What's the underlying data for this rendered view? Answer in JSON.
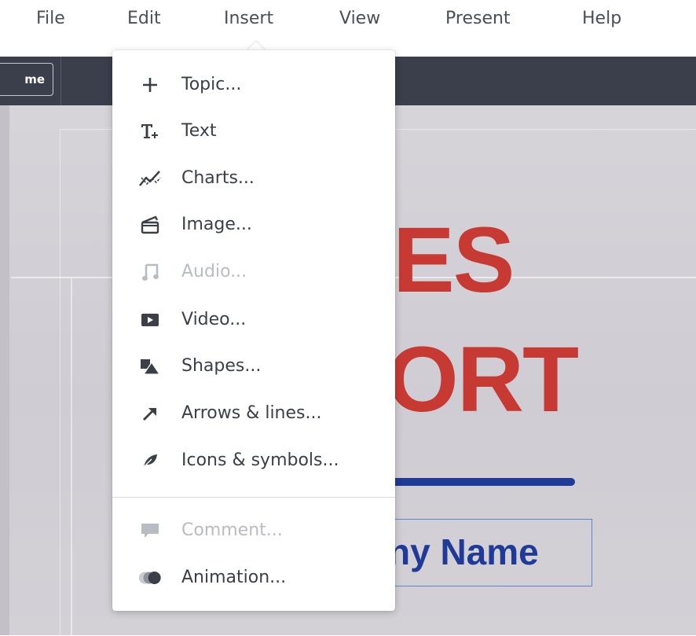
{
  "menubar": {
    "items": [
      {
        "label": "File"
      },
      {
        "label": "Edit"
      },
      {
        "label": "Insert"
      },
      {
        "label": "View"
      },
      {
        "label": "Present"
      },
      {
        "label": "Help"
      }
    ]
  },
  "toolbar": {
    "theme_button_label": "me"
  },
  "slide": {
    "title_line_1": "ES",
    "title_line_2": "ORT",
    "subtitle": "ny Name",
    "colors": {
      "title": "#c63a33",
      "accent": "#1f3a97"
    }
  },
  "insert_menu": {
    "items": [
      {
        "label": "Topic...",
        "icon": "plus-icon",
        "enabled": true
      },
      {
        "label": "Text",
        "icon": "text-icon",
        "enabled": true
      },
      {
        "label": "Charts...",
        "icon": "chart-icon",
        "enabled": true
      },
      {
        "label": "Image...",
        "icon": "image-icon",
        "enabled": true
      },
      {
        "label": "Audio...",
        "icon": "music-note-icon",
        "enabled": false
      },
      {
        "label": "Video...",
        "icon": "video-icon",
        "enabled": true
      },
      {
        "label": "Shapes...",
        "icon": "shapes-icon",
        "enabled": true
      },
      {
        "label": "Arrows & lines...",
        "icon": "arrow-icon",
        "enabled": true
      },
      {
        "label": "Icons & symbols...",
        "icon": "leaf-icon",
        "enabled": true
      },
      {
        "label": "Comment...",
        "icon": "comment-icon",
        "enabled": false
      },
      {
        "label": "Animation...",
        "icon": "animation-icon",
        "enabled": true
      }
    ]
  }
}
